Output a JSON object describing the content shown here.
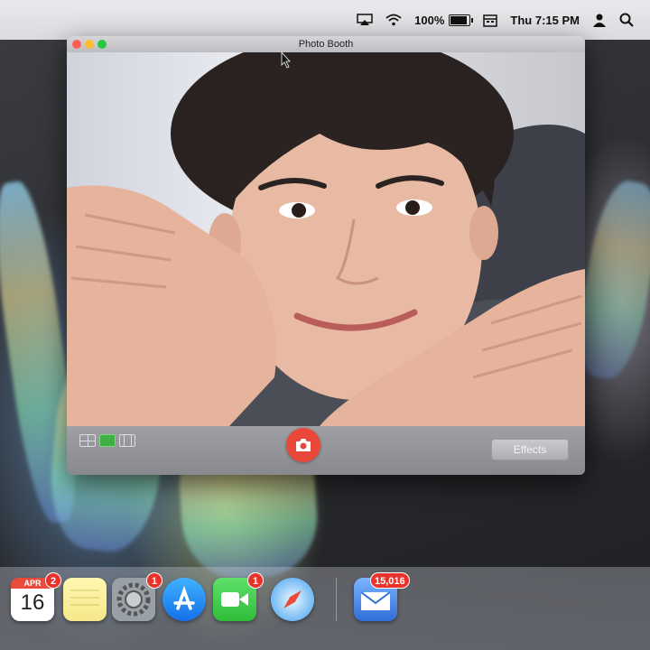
{
  "menubar": {
    "battery_percent": "100%",
    "battery_level": 1.0,
    "clock": "Thu 7:15 PM",
    "icons": [
      "airplay-icon",
      "wifi-icon",
      "battery-icon",
      "calendar-icon",
      "user-icon",
      "spotlight-search-icon"
    ]
  },
  "window": {
    "title": "Photo Booth",
    "effects_label": "Effects",
    "view_modes": [
      "grid-view-icon",
      "single-photo-view-icon",
      "film-strip-view-icon"
    ],
    "shutter_icon": "camera-icon"
  },
  "dock": {
    "calendar": {
      "month": "APR",
      "day": "16",
      "badge": "2"
    },
    "system_preferences_badge": "1",
    "facetime_badge": "1",
    "mail_badge": "15,016",
    "items": [
      "calendar-icon",
      "notes-icon",
      "system-preferences-icon",
      "app-store-icon",
      "facetime-icon",
      "safari-icon",
      "mail-icon"
    ]
  },
  "colors": {
    "shutter": "#e8473a",
    "badge": "#e8322a",
    "traffic_close": "#ff5f57",
    "traffic_min": "#febc2e",
    "traffic_max": "#28c840"
  }
}
